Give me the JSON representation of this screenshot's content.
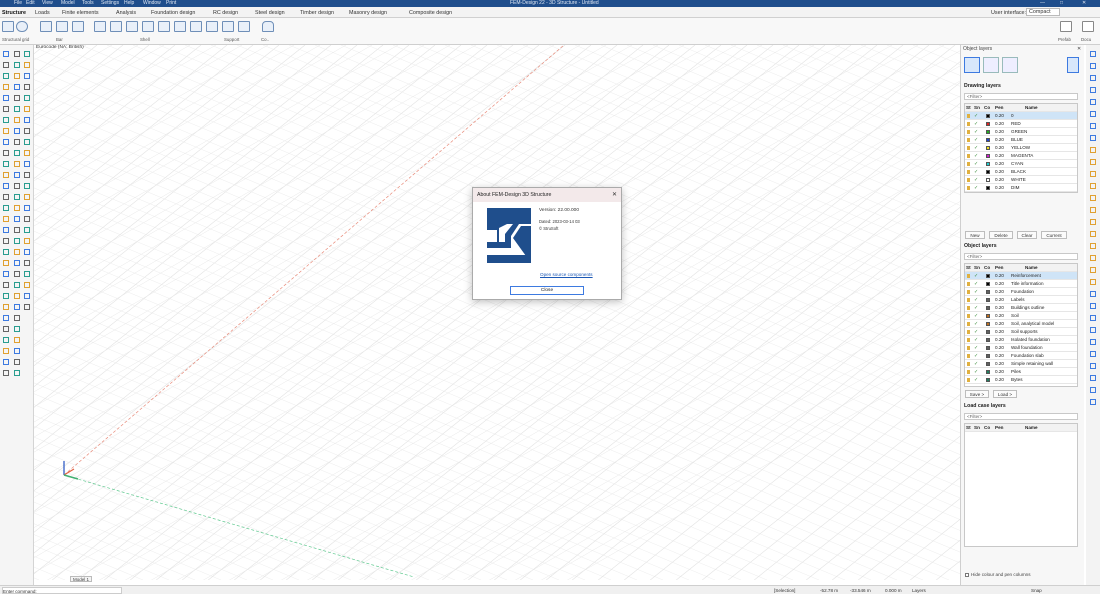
{
  "window": {
    "title": "FEM-Design 22 - 3D Structure - Untitled",
    "menu": [
      "File",
      "Edit",
      "View",
      "Model",
      "Tools",
      "Settings",
      "Help",
      "Window",
      "Print"
    ]
  },
  "ribbon": {
    "tabs": [
      "Structure",
      "Loads",
      "Finite elements",
      "Analysis",
      "Foundation design",
      "RC design",
      "Steel design",
      "Timber design",
      "Masonry design",
      "Composite design"
    ],
    "active_tab": "Structure",
    "right_label": "User interface:",
    "right_value": "Compact",
    "groups": [
      "Structural grid",
      "Bar",
      "Shell",
      "Support",
      "Co.."
    ],
    "right_buttons": [
      "Prefab",
      "Docu"
    ]
  },
  "viewport": {
    "label": "Eurocode (NA: British)",
    "model_tab": "Model 1"
  },
  "layers_panel": {
    "title": "Object layers",
    "drawing_layers": {
      "title": "Drawing layers",
      "filter": "<Filter>",
      "columns": [
        "St",
        "Sn",
        "Co",
        "Pen",
        "Name"
      ],
      "rows": [
        {
          "pen": "0.20",
          "name": "0",
          "color": "#000000"
        },
        {
          "pen": "0.20",
          "name": "RED",
          "color": "#e02020"
        },
        {
          "pen": "0.20",
          "name": "GREEN",
          "color": "#20b020"
        },
        {
          "pen": "0.20",
          "name": "BLUE",
          "color": "#2040d0"
        },
        {
          "pen": "0.20",
          "name": "YELLOW",
          "color": "#f0e020"
        },
        {
          "pen": "0.20",
          "name": "MAGENTA",
          "color": "#d020d0"
        },
        {
          "pen": "0.20",
          "name": "CYAN",
          "color": "#20d0d0"
        },
        {
          "pen": "0.20",
          "name": "BLACK",
          "color": "#000000"
        },
        {
          "pen": "0.20",
          "name": "WHITE",
          "color": "#ffffff"
        },
        {
          "pen": "0.20",
          "name": "DIM",
          "color": "#000000"
        }
      ],
      "buttons": [
        "New",
        "Delete",
        "Clear",
        "Current"
      ]
    },
    "object_layers": {
      "title": "Object layers",
      "filter": "<Filter>",
      "columns": [
        "St",
        "Sn",
        "Co",
        "Pen",
        "Name"
      ],
      "rows": [
        {
          "pen": "0.20",
          "name": "Reinforcement",
          "color": "#000000"
        },
        {
          "pen": "0.20",
          "name": "Title information",
          "color": "#000000"
        },
        {
          "pen": "0.20",
          "name": "Foundation",
          "color": "#606060"
        },
        {
          "pen": "0.20",
          "name": "Labels",
          "color": "#606060"
        },
        {
          "pen": "0.20",
          "name": "Buildings outline",
          "color": "#606060"
        },
        {
          "pen": "0.20",
          "name": "Soil",
          "color": "#c07020"
        },
        {
          "pen": "0.20",
          "name": "Soil, analytical model",
          "color": "#c07020"
        },
        {
          "pen": "0.20",
          "name": "Soil supports",
          "color": "#606060"
        },
        {
          "pen": "0.20",
          "name": "Isolated foundation",
          "color": "#606060"
        },
        {
          "pen": "0.20",
          "name": "Wall foundation",
          "color": "#606060"
        },
        {
          "pen": "0.20",
          "name": "Foundation slab",
          "color": "#606060"
        },
        {
          "pen": "0.20",
          "name": "Simple retaining wall",
          "color": "#606060"
        },
        {
          "pen": "0.20",
          "name": "Piles",
          "color": "#208060"
        },
        {
          "pen": "0.20",
          "name": "Bytes",
          "color": "#208060"
        }
      ],
      "buttons": [
        "Save >",
        "Load >"
      ]
    },
    "load_case_layers": {
      "title": "Load case layers",
      "filter": "<Filter>",
      "columns": [
        "St",
        "Sn",
        "Co",
        "Pen",
        "Name"
      ]
    },
    "footer": "Hide colour and pen columns"
  },
  "dialog": {
    "title": "About FEM-Design 3D Structure",
    "version": "Version: 22.00.000",
    "build": "Dated: 2023-03-14 03",
    "company": "© StruSoft",
    "link": "Open source components",
    "close_label": "Close"
  },
  "statusbar": {
    "command": "Enter command:",
    "selection": "[Selection]",
    "x": "-52.78 m",
    "y": "-33.546 m",
    "z": "0.000 m",
    "layers": "Layers",
    "snap": "Snap"
  }
}
